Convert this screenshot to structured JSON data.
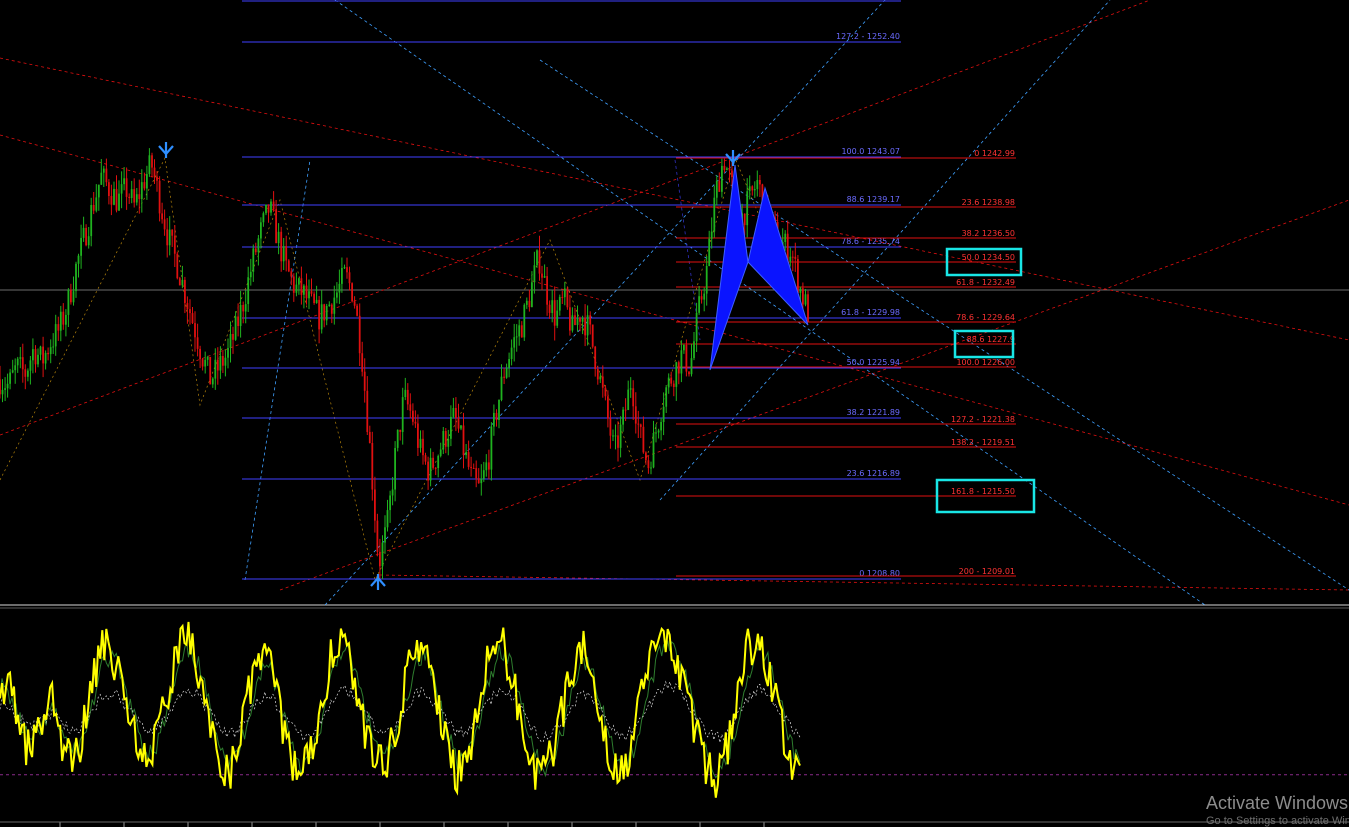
{
  "colors": {
    "background": "#000000",
    "bull_candle": "#1fb31f",
    "bear_candle": "#e01010",
    "fib_retrace": "#4040ff",
    "fib_retrace_text": "#6b6bff",
    "fib_extension": "#e01010",
    "fib_extension_text": "#ff3333",
    "channel_dashed": "#e01010",
    "fan_dashed": "#3fa0ff",
    "pattern_fill": "#0a14ff",
    "highlight_box": "#19e6e6",
    "arrow": "#2f8fff",
    "stoch_main": "#ffff00",
    "stoch_signal": "#2e7d2e",
    "stoch_level": "#8a2a8a"
  },
  "icons": {
    "top_arrow": "down-arrow-icon",
    "bottom_arrow": "up-arrow-icon"
  },
  "chart_data": [
    {
      "type": "line",
      "title": "",
      "xlabel": "",
      "ylabel": "",
      "ylim": [
        1208.5,
        1253.0
      ],
      "grid": false,
      "price_series": [
        1225.0,
        1224.5,
        1226.0,
        1225.5,
        1227.5,
        1226.5,
        1228.0,
        1229.0,
        1231.0,
        1234.0,
        1236.5,
        1239.0,
        1241.5,
        1240.5,
        1239.5,
        1240.5,
        1239.0,
        1241.0,
        1242.5,
        1239.5,
        1236.5,
        1234.5,
        1232.0,
        1229.5,
        1227.0,
        1225.0,
        1226.0,
        1227.0,
        1229.0,
        1231.5,
        1234.5,
        1237.0,
        1239.0,
        1236.5,
        1234.0,
        1232.5,
        1232.0,
        1231.0,
        1230.0,
        1231.0,
        1232.0,
        1233.5,
        1232.0,
        1227.0,
        1219.0,
        1210.0,
        1213.0,
        1219.0,
        1223.5,
        1222.0,
        1219.0,
        1217.5,
        1219.0,
        1220.5,
        1222.0,
        1219.5,
        1217.0,
        1216.0,
        1218.5,
        1222.5,
        1226.0,
        1228.0,
        1229.5,
        1232.0,
        1235.0,
        1232.0,
        1230.0,
        1231.5,
        1229.0,
        1230.5,
        1229.0,
        1226.0,
        1222.5,
        1219.0,
        1221.5,
        1225.0,
        1220.5,
        1218.0,
        1221.0,
        1224.0,
        1225.5,
        1227.0,
        1226.0,
        1230.5,
        1234.0,
        1240.0,
        1243.0,
        1240.5,
        1238.0,
        1239.5,
        1241.0,
        1238.5,
        1237.0,
        1236.0,
        1235.5,
        1232.5,
        1230.5
      ],
      "fibonacci_retracement": {
        "levels": [
          {
            "label": "127.2 - 1252.40"
          },
          {
            "label": "100.0 1243.07"
          },
          {
            "label": "88.6 1239.17"
          },
          {
            "label": "78.6 - 1235.74"
          },
          {
            "label": "61.8 - 1229.98"
          },
          {
            "label": "50.0 1225.94"
          },
          {
            "label": "38.2 1221.89"
          },
          {
            "label": "23.6 1216.89"
          },
          {
            "label": "0 1208.80"
          }
        ]
      },
      "fibonacci_extension": {
        "levels": [
          {
            "label": "0 1242.99"
          },
          {
            "label": "23.6 1238.98"
          },
          {
            "label": "38.2 1236.50"
          },
          {
            "label": "50.0 1234.50",
            "highlighted": true
          },
          {
            "label": "61.8 - 1232.49"
          },
          {
            "label": "78.6 - 1229.64"
          },
          {
            "label": "88.6 1227.9",
            "highlighted": true
          },
          {
            "label": "100.0 1226.00"
          },
          {
            "label": "127.2 - 1221.38"
          },
          {
            "label": "138.2 - 1219.51"
          },
          {
            "label": "161.8 - 1215.50",
            "highlighted": true
          },
          {
            "label": "200 - 1209.01"
          }
        ]
      }
    },
    {
      "type": "line",
      "title": "",
      "ylim": [
        0,
        100
      ],
      "level": 20,
      "series": [
        {
          "values": [
            70,
            62,
            40,
            30,
            48,
            60,
            36,
            22,
            42,
            68,
            88,
            78,
            58,
            40,
            26,
            36,
            58,
            80,
            90,
            74,
            50,
            32,
            20,
            38,
            62,
            82,
            74,
            50,
            30,
            18,
            34,
            58,
            84,
            90,
            70,
            46,
            30,
            24,
            42,
            66,
            88,
            80,
            56,
            34,
            20,
            30,
            54,
            78,
            92,
            76,
            52,
            30,
            16,
            28,
            50,
            74,
            86,
            66,
            44,
            28,
            20,
            40,
            66,
            84,
            92,
            82,
            60,
            40,
            24,
            16,
            34,
            60,
            84,
            90,
            72,
            50,
            28,
            20
          ]
        },
        {
          "values": [
            66,
            60,
            46,
            36,
            44,
            54,
            42,
            30,
            38,
            58,
            78,
            80,
            64,
            48,
            32,
            34,
            50,
            70,
            84,
            78,
            58,
            40,
            26,
            32,
            52,
            72,
            76,
            58,
            38,
            24,
            28,
            48,
            72,
            86,
            76,
            56,
            38,
            28,
            36,
            56,
            78,
            82,
            64,
            44,
            28,
            28,
            44,
            66,
            84,
            80,
            62,
            40,
            24,
            24,
            40,
            62,
            80,
            72,
            52,
            34,
            24,
            32,
            54,
            74,
            88,
            86,
            70,
            50,
            32,
            22,
            28,
            48,
            72,
            86,
            78,
            58,
            38,
            26
          ]
        }
      ]
    }
  ],
  "watermark": {
    "line1": "Activate Windows",
    "line2": "Go to Settings to activate Windows."
  }
}
